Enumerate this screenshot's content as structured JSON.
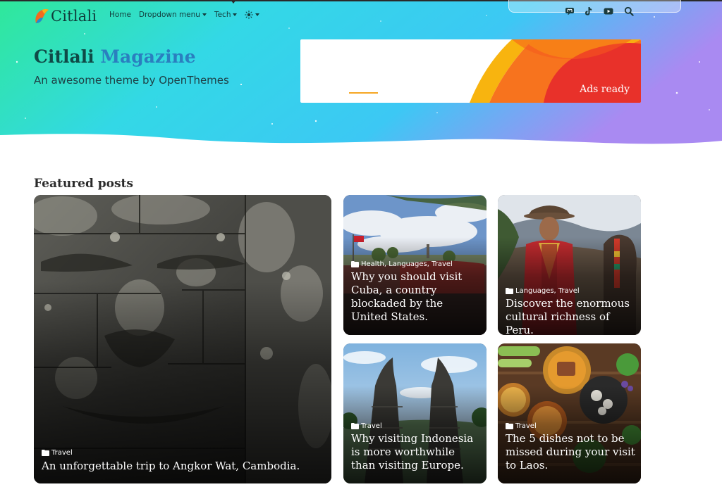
{
  "site": {
    "logo_text": "Citlali",
    "title_part1": "Citlali",
    "title_part2": "Magazine",
    "subtitle": "An awesome theme by OpenThemes"
  },
  "nav": {
    "items": [
      {
        "label": "Home",
        "dropdown": false
      },
      {
        "label": "Dropdown menu",
        "dropdown": true
      },
      {
        "label": "Tech",
        "dropdown": true
      }
    ],
    "theme_toggle_icon": "sun-icon"
  },
  "social": [
    "mastodon-icon",
    "tiktok-icon",
    "youtube-icon",
    "search-icon"
  ],
  "ad": {
    "label": "Ads ready"
  },
  "colors": {
    "hero_gradient": [
      "#2fe89a",
      "#35d3f0",
      "#3cc8f4",
      "#a98af2"
    ],
    "brand_dark": "#0f4a47",
    "brand_accent": "#2a7fbf",
    "ad_orange": "#f7731e",
    "ad_red": "#e8312a",
    "ad_yellow": "#f8b40f"
  },
  "featured": {
    "heading": "Featured posts",
    "posts": [
      {
        "category": "Travel",
        "title": "An unforgettable trip to Angkor Wat, Cambodia."
      },
      {
        "category": "Health, Languages, Travel",
        "title": "Why you should visit Cuba, a country blockaded by the United States."
      },
      {
        "category": "Languages, Travel",
        "title": "Discover the enormous cultural richness of Peru."
      },
      {
        "category": "Travel",
        "title": "Why visiting Indonesia is more worthwhile than visiting Europe."
      },
      {
        "category": "Travel",
        "title": "The 5 dishes not to be missed during your visit to Laos."
      }
    ]
  }
}
